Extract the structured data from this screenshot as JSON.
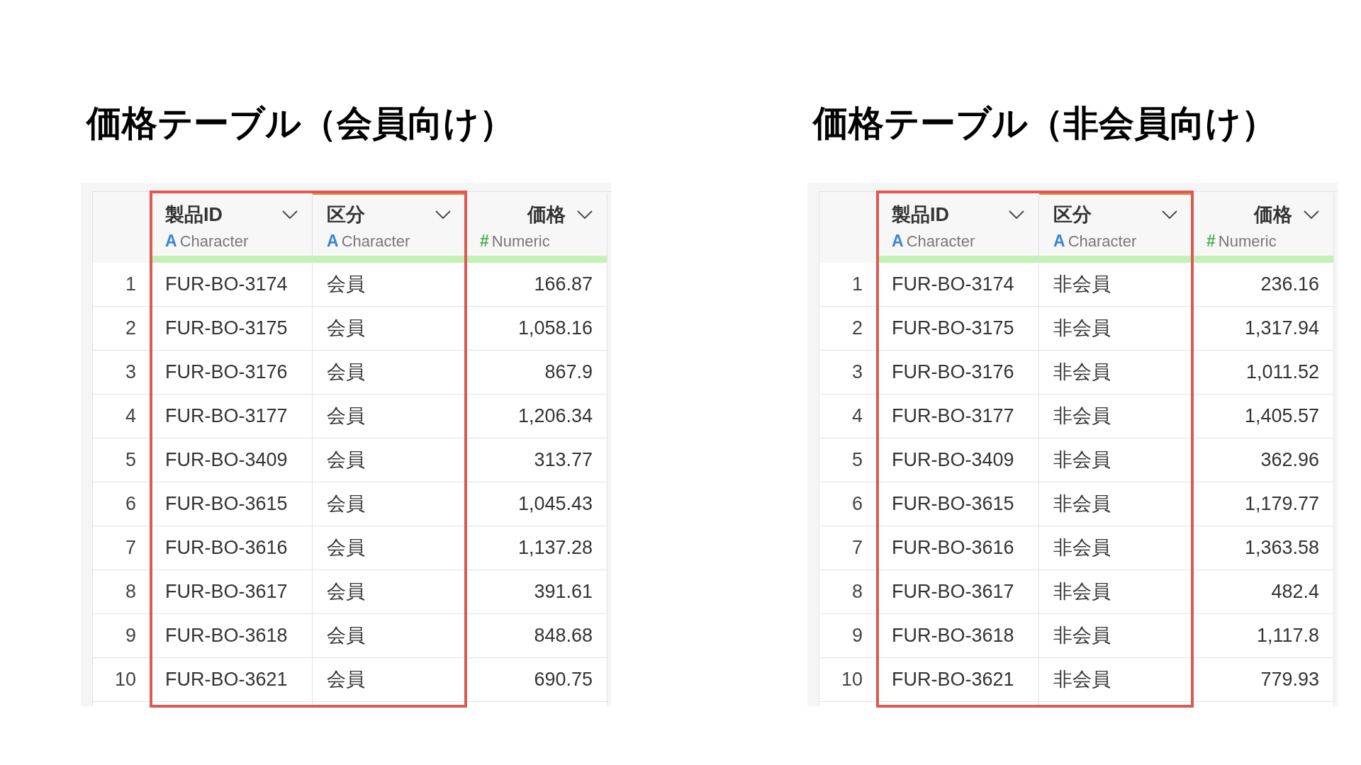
{
  "tables": [
    {
      "title": "価格テーブル（会員向け）",
      "columns": [
        {
          "name": "製品ID",
          "type_icon": "A",
          "type_label": "Character",
          "kind": "character",
          "highlighted": true,
          "selected": false
        },
        {
          "name": "区分",
          "type_icon": "A",
          "type_label": "Character",
          "kind": "character",
          "highlighted": true,
          "selected": true
        },
        {
          "name": "価格",
          "type_icon": "#",
          "type_label": "Numeric",
          "kind": "numeric",
          "highlighted": false,
          "selected": false
        }
      ],
      "rows": [
        {
          "num": "1",
          "cells": [
            "FUR-BO-3174",
            "会員",
            "166.87"
          ]
        },
        {
          "num": "2",
          "cells": [
            "FUR-BO-3175",
            "会員",
            "1,058.16"
          ]
        },
        {
          "num": "3",
          "cells": [
            "FUR-BO-3176",
            "会員",
            "867.9"
          ]
        },
        {
          "num": "4",
          "cells": [
            "FUR-BO-3177",
            "会員",
            "1,206.34"
          ]
        },
        {
          "num": "5",
          "cells": [
            "FUR-BO-3409",
            "会員",
            "313.77"
          ]
        },
        {
          "num": "6",
          "cells": [
            "FUR-BO-3615",
            "会員",
            "1,045.43"
          ]
        },
        {
          "num": "7",
          "cells": [
            "FUR-BO-3616",
            "会員",
            "1,137.28"
          ]
        },
        {
          "num": "8",
          "cells": [
            "FUR-BO-3617",
            "会員",
            "391.61"
          ]
        },
        {
          "num": "9",
          "cells": [
            "FUR-BO-3618",
            "会員",
            "848.68"
          ]
        },
        {
          "num": "10",
          "cells": [
            "FUR-BO-3621",
            "会員",
            "690.75"
          ]
        }
      ]
    },
    {
      "title": "価格テーブル（非会員向け）",
      "columns": [
        {
          "name": "製品ID",
          "type_icon": "A",
          "type_label": "Character",
          "kind": "character",
          "highlighted": true,
          "selected": false
        },
        {
          "name": "区分",
          "type_icon": "A",
          "type_label": "Character",
          "kind": "character",
          "highlighted": true,
          "selected": true
        },
        {
          "name": "価格",
          "type_icon": "#",
          "type_label": "Numeric",
          "kind": "numeric",
          "highlighted": false,
          "selected": false
        }
      ],
      "rows": [
        {
          "num": "1",
          "cells": [
            "FUR-BO-3174",
            "非会員",
            "236.16"
          ]
        },
        {
          "num": "2",
          "cells": [
            "FUR-BO-3175",
            "非会員",
            "1,317.94"
          ]
        },
        {
          "num": "3",
          "cells": [
            "FUR-BO-3176",
            "非会員",
            "1,011.52"
          ]
        },
        {
          "num": "4",
          "cells": [
            "FUR-BO-3177",
            "非会員",
            "1,405.57"
          ]
        },
        {
          "num": "5",
          "cells": [
            "FUR-BO-3409",
            "非会員",
            "362.96"
          ]
        },
        {
          "num": "6",
          "cells": [
            "FUR-BO-3615",
            "非会員",
            "1,179.77"
          ]
        },
        {
          "num": "7",
          "cells": [
            "FUR-BO-3616",
            "非会員",
            "1,363.58"
          ]
        },
        {
          "num": "8",
          "cells": [
            "FUR-BO-3617",
            "非会員",
            "482.4"
          ]
        },
        {
          "num": "9",
          "cells": [
            "FUR-BO-3618",
            "非会員",
            "1,117.8"
          ]
        },
        {
          "num": "10",
          "cells": [
            "FUR-BO-3621",
            "非会員",
            "779.93"
          ]
        }
      ]
    }
  ]
}
